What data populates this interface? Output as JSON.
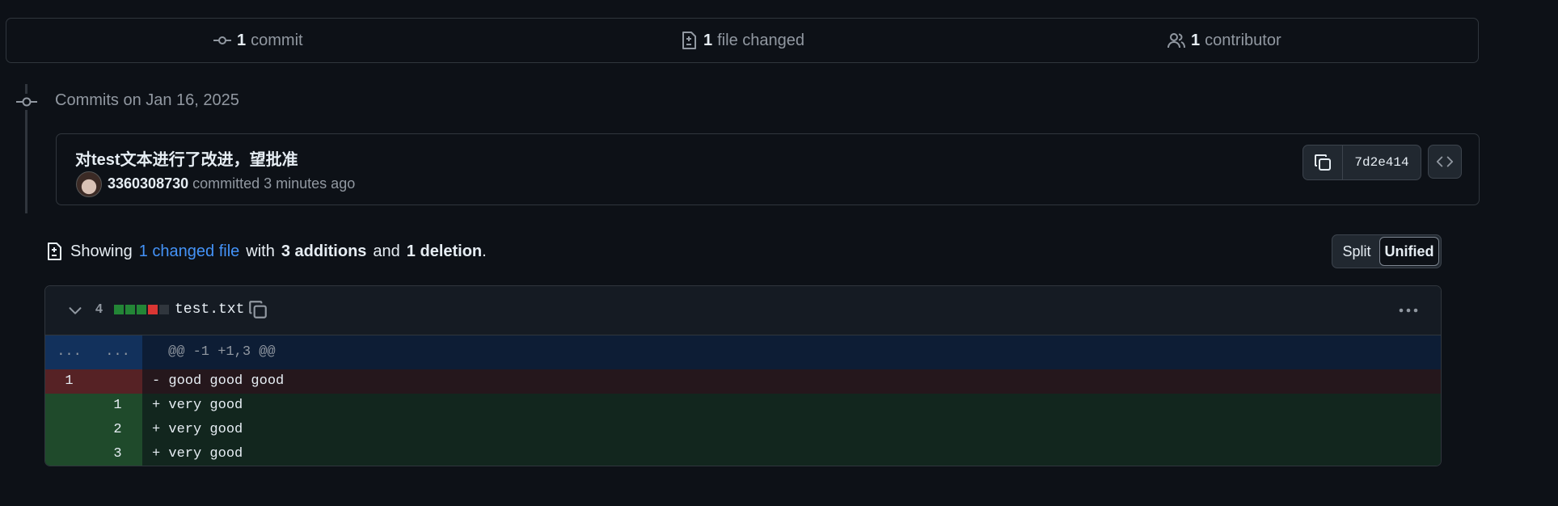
{
  "summary": {
    "commits": {
      "count": "1",
      "label": "commit"
    },
    "files": {
      "count": "1",
      "label": "file changed"
    },
    "contributors": {
      "count": "1",
      "label": "contributor"
    }
  },
  "timeline": {
    "heading": "Commits on Jan 16, 2025"
  },
  "commit": {
    "message": "对test文本进行了改进，望批准",
    "author": "3360308730",
    "action": "committed 3 minutes ago",
    "sha": "7d2e414"
  },
  "showing": {
    "prefix": "Showing",
    "changed_link": "1 changed file",
    "with": "with",
    "additions": "3 additions",
    "and": "and",
    "deletions": "1 deletion",
    "period": "."
  },
  "view_toggle": {
    "split": "Split",
    "unified": "Unified",
    "selected": "Unified"
  },
  "diff": {
    "changes": "4",
    "filename": "test.txt",
    "diffstat_colors": [
      "#238636",
      "#238636",
      "#238636",
      "#da3633",
      "#30363d"
    ],
    "hunk": {
      "left": "...",
      "right": "...",
      "header": "@@ -1 +1,3 @@"
    },
    "lines": [
      {
        "type": "del",
        "old": "1",
        "new": "",
        "sign": "-",
        "text": "good good good"
      },
      {
        "type": "add",
        "old": "",
        "new": "1",
        "sign": "+",
        "text": "very good"
      },
      {
        "type": "add",
        "old": "",
        "new": "2",
        "sign": "+",
        "text": "very good"
      },
      {
        "type": "add",
        "old": "",
        "new": "3",
        "sign": "+",
        "text": "very good"
      }
    ]
  }
}
